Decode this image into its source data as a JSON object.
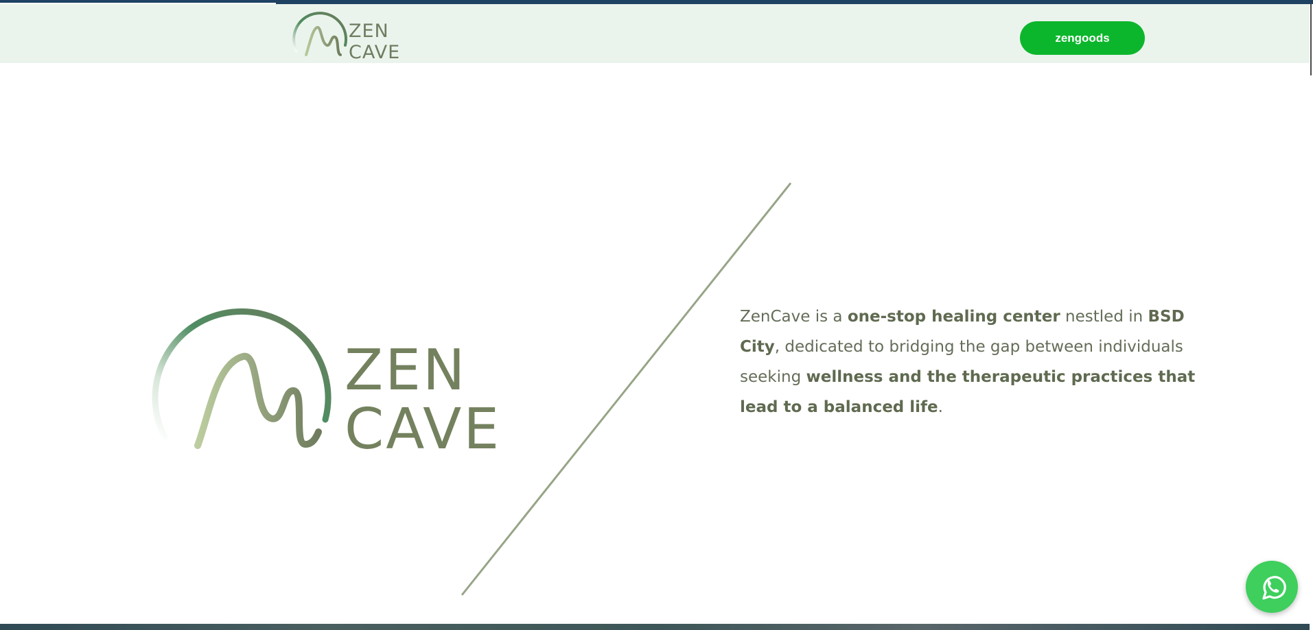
{
  "header": {
    "logo": {
      "line1": "ZEN",
      "line2": "CAVE"
    },
    "cta_label": "zengoods"
  },
  "hero": {
    "logo": {
      "line1": "ZEN",
      "line2": "CAVE"
    },
    "intro": {
      "t1": "ZenCave is a ",
      "b1": "one-stop healing center",
      "t2": " nestled in ",
      "b2": "BSD City",
      "t3": ", dedicated to bridging the gap between individuals seeking ",
      "b3": "wellness and the therapeutic practices that lead to a balanced life",
      "t4": "."
    }
  },
  "floating": {
    "whatsapp_icon": "whatsapp-icon"
  },
  "colors": {
    "header_bg": "#ebf4ec",
    "accent_green": "#0cb62c",
    "logo_green": "#74815e",
    "whatsapp_green": "#3ecf5d"
  }
}
